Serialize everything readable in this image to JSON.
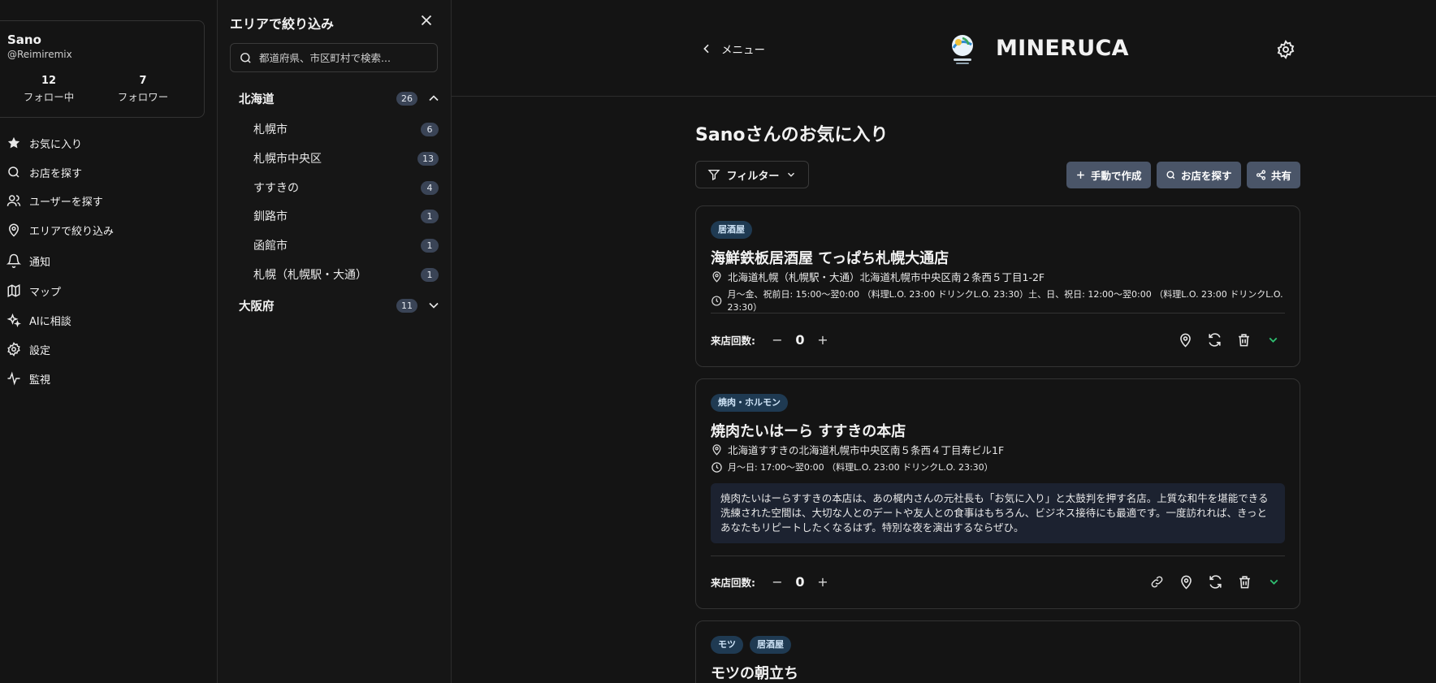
{
  "profile": {
    "name": "Sano",
    "handle": "@Reimiremix",
    "following_count": "12",
    "following_label": "フォロー中",
    "followers_count": "7",
    "followers_label": "フォロワー"
  },
  "nav": {
    "items": [
      {
        "label": "お気に入り",
        "icon": "star-icon"
      },
      {
        "label": "お店を探す",
        "icon": "search-icon"
      },
      {
        "label": "ユーザーを探す",
        "icon": "users-icon"
      },
      {
        "label": "エリアで絞り込み",
        "icon": "map-pin-icon"
      },
      {
        "label": "通知",
        "icon": "bell-icon"
      },
      {
        "label": "マップ",
        "icon": "map-icon"
      },
      {
        "label": "AIに相談",
        "icon": "sparkles-icon"
      },
      {
        "label": "設定",
        "icon": "gear-icon"
      },
      {
        "label": "監視",
        "icon": "activity-icon"
      }
    ]
  },
  "area_panel": {
    "title": "エリアで絞り込み",
    "search_placeholder": "都道府県、市区町村で検索...",
    "prefectures": [
      {
        "name": "北海道",
        "count": "26",
        "expanded": true,
        "cities": [
          {
            "name": "札幌市",
            "count": "6"
          },
          {
            "name": "札幌市中央区",
            "count": "13"
          },
          {
            "name": "すすきの",
            "count": "4"
          },
          {
            "name": "釧路市",
            "count": "1"
          },
          {
            "name": "函館市",
            "count": "1"
          },
          {
            "name": "札幌（札幌駅・大通）",
            "count": "1"
          }
        ]
      },
      {
        "name": "大阪府",
        "count": "11",
        "expanded": false,
        "cities": []
      }
    ]
  },
  "header": {
    "back_label": "メニュー",
    "app_title": "MINERUCA"
  },
  "page": {
    "title": "Sanoさんのお気に入り",
    "filter_label": "フィルター",
    "manual_create_label": "手動で作成",
    "find_shop_label": "お店を探す",
    "share_label": "共有"
  },
  "visit_label": "来店回数:",
  "cards": [
    {
      "tags": [
        "居酒屋"
      ],
      "name": "海鮮鉄板居酒屋 てっぱち札幌大通店",
      "address": "北海道札幌（札幌駅・大通）北海道札幌市中央区南２条西５丁目1-2F",
      "hours": "月〜金、祝前日: 15:00〜翌0:00 （料理L.O. 23:00 ドリンクL.O. 23:30）土、日、祝日: 12:00〜翌0:00 （料理L.O. 23:00 ドリンクL.O. 23:30）",
      "description": "",
      "visits": "0"
    },
    {
      "tags": [
        "焼肉・ホルモン"
      ],
      "name": "焼肉たいはーら すすきの本店",
      "address": "北海道すすきの北海道札幌市中央区南５条西４丁目寿ビル1F",
      "hours": "月〜日: 17:00〜翌0:00 （料理L.O. 23:00 ドリンクL.O. 23:30）",
      "description": "焼肉たいはーらすすきの本店は、あの梶内さんの元社長も「お気に入り」と太鼓判を押す名店。上質な和牛を堪能できる洗練された空間は、大切な人とのデートや友人との食事はもちろん、ビジネス接待にも最適です。一度訪れれば、きっとあなたもリピートしたくなるはず。特別な夜を演出するならぜひ。",
      "visits": "0"
    },
    {
      "tags": [
        "モツ",
        "居酒屋"
      ],
      "name": "モツの朝立ち",
      "address": "",
      "hours": "",
      "description": "",
      "visits": ""
    }
  ]
}
